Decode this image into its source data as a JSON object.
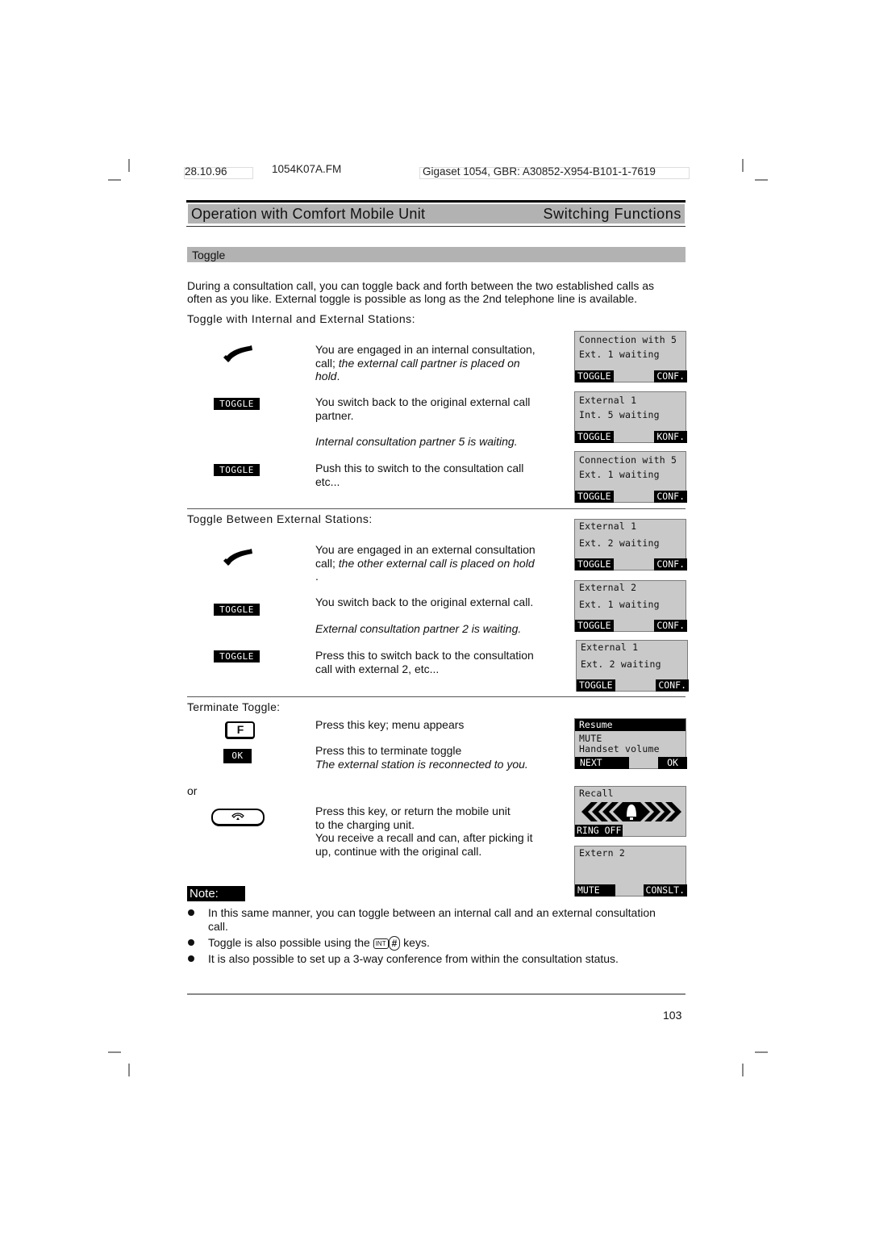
{
  "print_header": {
    "date": "28.10.96",
    "file": "1054K07A.FM",
    "product": "Gigaset 1054, GBR: A30852-X954-B101-1-7619"
  },
  "page_header": {
    "left_title": "Operation with Comfort Mobile Unit",
    "right_title": "Switching Functions"
  },
  "section": {
    "title": "Toggle",
    "intro_line1": "During a consultation call, you can toggle back and forth between the two established calls as",
    "intro_line2": "often as you like. External toggle is possible as long as the 2nd telephone line is available."
  },
  "internal_external": {
    "heading": "Toggle with Internal and External Stations:",
    "steps": [
      {
        "icon": "handset-lifted-icon",
        "text_plain": "You are engaged in an internal consultation,",
        "text_plain2": "call; ",
        "text_italic": "the external call partner is placed on",
        "text_italic2": "hold",
        "text_end": "."
      },
      {
        "key": "TOGGLE",
        "text1": "You switch back to the original external call",
        "text2": "partner.",
        "result": "Internal consultation partner 5 is waiting."
      },
      {
        "key": "TOGGLE",
        "text1": "Push this to switch to the consultation call",
        "text2": "etc..."
      }
    ],
    "screens": [
      {
        "line1": "Connection with 5",
        "line2": "Ext. 1 waiting",
        "left_key": "TOGGLE",
        "right_key": "CONF."
      },
      {
        "line1": "External 1",
        "line2": "Int. 5 waiting",
        "left_key": "TOGGLE",
        "right_key": "KONF."
      },
      {
        "line1": "Connection with 5",
        "line2": "Ext. 1 waiting",
        "left_key": "TOGGLE",
        "right_key": "CONF."
      }
    ]
  },
  "external_external": {
    "heading": "Toggle Between External Stations:",
    "steps": [
      {
        "icon": "handset-lifted-icon",
        "text_plain": "You are engaged in an external consultation",
        "text_plain2": "call; ",
        "text_italic": "the other external call is placed on hold",
        "text_end": "."
      },
      {
        "key": "TOGGLE",
        "text1": "You switch back to the original external call.",
        "result": "External consultation partner 2 is waiting."
      },
      {
        "key": "TOGGLE",
        "text1": "Press this to switch back to the consultation",
        "text2": "call with external 2, etc..."
      }
    ],
    "screens": [
      {
        "line1": "External 1",
        "line2": "Ext. 2 waiting",
        "left_key": "TOGGLE",
        "right_key": "CONF."
      },
      {
        "line1": "External 2",
        "line2": "Ext. 1 waiting",
        "left_key": "TOGGLE",
        "right_key": "CONF."
      },
      {
        "line1": "External 1",
        "line2": "Ext. 2 waiting",
        "left_key": "TOGGLE",
        "right_key": "CONF."
      }
    ]
  },
  "terminate": {
    "heading": "Terminate Toggle:",
    "f_key": "F",
    "f_text": "Press this key; menu appears",
    "ok_key": "OK",
    "ok_text": "Press this to terminate toggle",
    "ok_result": "The external station is reconnected to you.",
    "or": "or",
    "end_text1": "Press this key, or return the mobile unit",
    "end_text2": "to the charging unit.",
    "end_text3": "You receive a recall and can, after picking it",
    "end_text4": "up, continue with the original call.",
    "menu_screen": {
      "selected": "Resume",
      "item2": "MUTE",
      "item3": "Handset volume",
      "left_key": "NEXT",
      "right_key": "OK"
    },
    "recall_screen": {
      "line1": "Recall",
      "left_key": "RING OFF"
    },
    "extern_screen": {
      "line1": "Extern 2",
      "left_key": "MUTE",
      "right_key": "CONSLT."
    }
  },
  "note": {
    "label": "Note:",
    "bullets": [
      {
        "line1": "In this same manner, you can toggle between an internal call and an external consultation",
        "line2": "call."
      },
      {
        "before": "Toggle is also possible using the",
        "key1": "INT",
        "key2": "#",
        "after": "keys."
      },
      {
        "line1": "It is also possible to set up a 3-way conference from within the consultation status."
      }
    ]
  },
  "footer": {
    "page_number": "103"
  }
}
